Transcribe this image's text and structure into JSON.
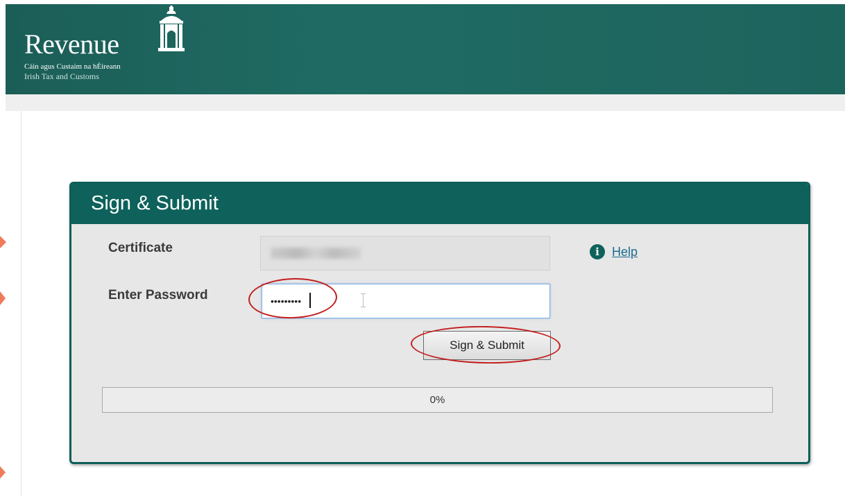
{
  "header": {
    "brand_name": "Revenue",
    "gaelic_tagline": "Cáin agus Custaim na hÉireann",
    "english_tagline": "Irish Tax and Customs",
    "crest_icon": "revenue-custom-house-crest-icon"
  },
  "dialog": {
    "title": "Sign & Submit",
    "certificate_label": "Certificate",
    "certificate_value": "",
    "password_label": "Enter Password",
    "password_value": "•••••••••",
    "help_label": "Help",
    "help_icon": "info-circle-icon",
    "submit_label": "Sign & Submit",
    "progress_percent": 0,
    "progress_text": "0%"
  },
  "colors": {
    "header_bg": "#1d645d",
    "dialog_title_bg": "#0e625b",
    "dialog_bg": "#e7e7e7",
    "link": "#1c6a8f",
    "annotation": "#c41d1d"
  }
}
